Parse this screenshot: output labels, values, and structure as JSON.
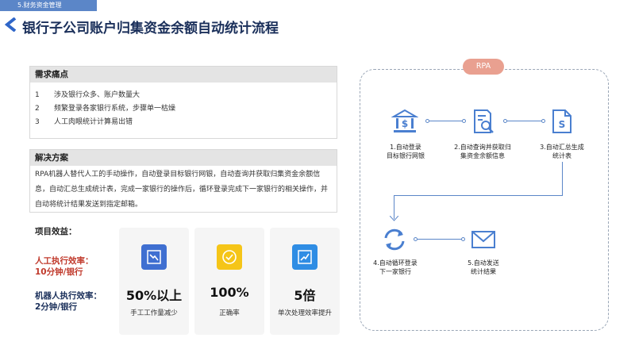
{
  "section_tag": "5.财务资金管理",
  "title": "银行子公司账户归集资金余额自动统计流程",
  "pain": {
    "heading": "需求痛点",
    "items": [
      {
        "num": "1",
        "text": "涉及银行众多、账户数量大"
      },
      {
        "num": "2",
        "text": "频繁登录各家银行系统，步骤单一枯燥"
      },
      {
        "num": "3",
        "text": "人工肉眼统计计算易出错"
      }
    ]
  },
  "solution": {
    "heading": "解决方案",
    "text": "RPA机器人替代人工的手动操作，自动登录目标银行网银，自动查询并获取归集资金余额信息，自动汇总生成统计表，完成一家银行的操作后，循环登录完成下一家银行的相关操作，并自动将统计结果发送到指定邮箱。"
  },
  "benefits": {
    "heading": "项目效益：",
    "manual_line1": "人工执行效率：",
    "manual_line2": "10分钟/银行",
    "robot_line1": "机器人执行效率：",
    "robot_line2": "2分钟/银行",
    "cards": [
      {
        "value": "50%以上",
        "caption": "手工工作量减少",
        "icon": "chart-down-icon"
      },
      {
        "value": "100%",
        "caption": "正确率",
        "icon": "check-circle-icon"
      },
      {
        "value": "5倍",
        "caption": "单次处理效率提升",
        "icon": "chart-up-icon"
      }
    ]
  },
  "rpa": {
    "label": "RPA",
    "steps": [
      {
        "line1": "1.自动登录",
        "line2": "目标银行网银",
        "icon": "bank-icon"
      },
      {
        "line1": "2.自动查询并获取归",
        "line2": "集资金余额信息",
        "icon": "document-search-icon"
      },
      {
        "line1": "3.自动汇总生成",
        "line2": "统计表",
        "icon": "dollar-file-icon"
      },
      {
        "line1": "4.自动循环登录",
        "line2": "下一家银行",
        "icon": "refresh-icon"
      },
      {
        "line1": "5.自动发送",
        "line2": "统计结果",
        "icon": "mail-icon"
      }
    ]
  },
  "colors": {
    "accent": "#5b86c8",
    "title": "#1a2f5a",
    "efficiency_red": "#c0392b",
    "pill": "#e9a090"
  }
}
